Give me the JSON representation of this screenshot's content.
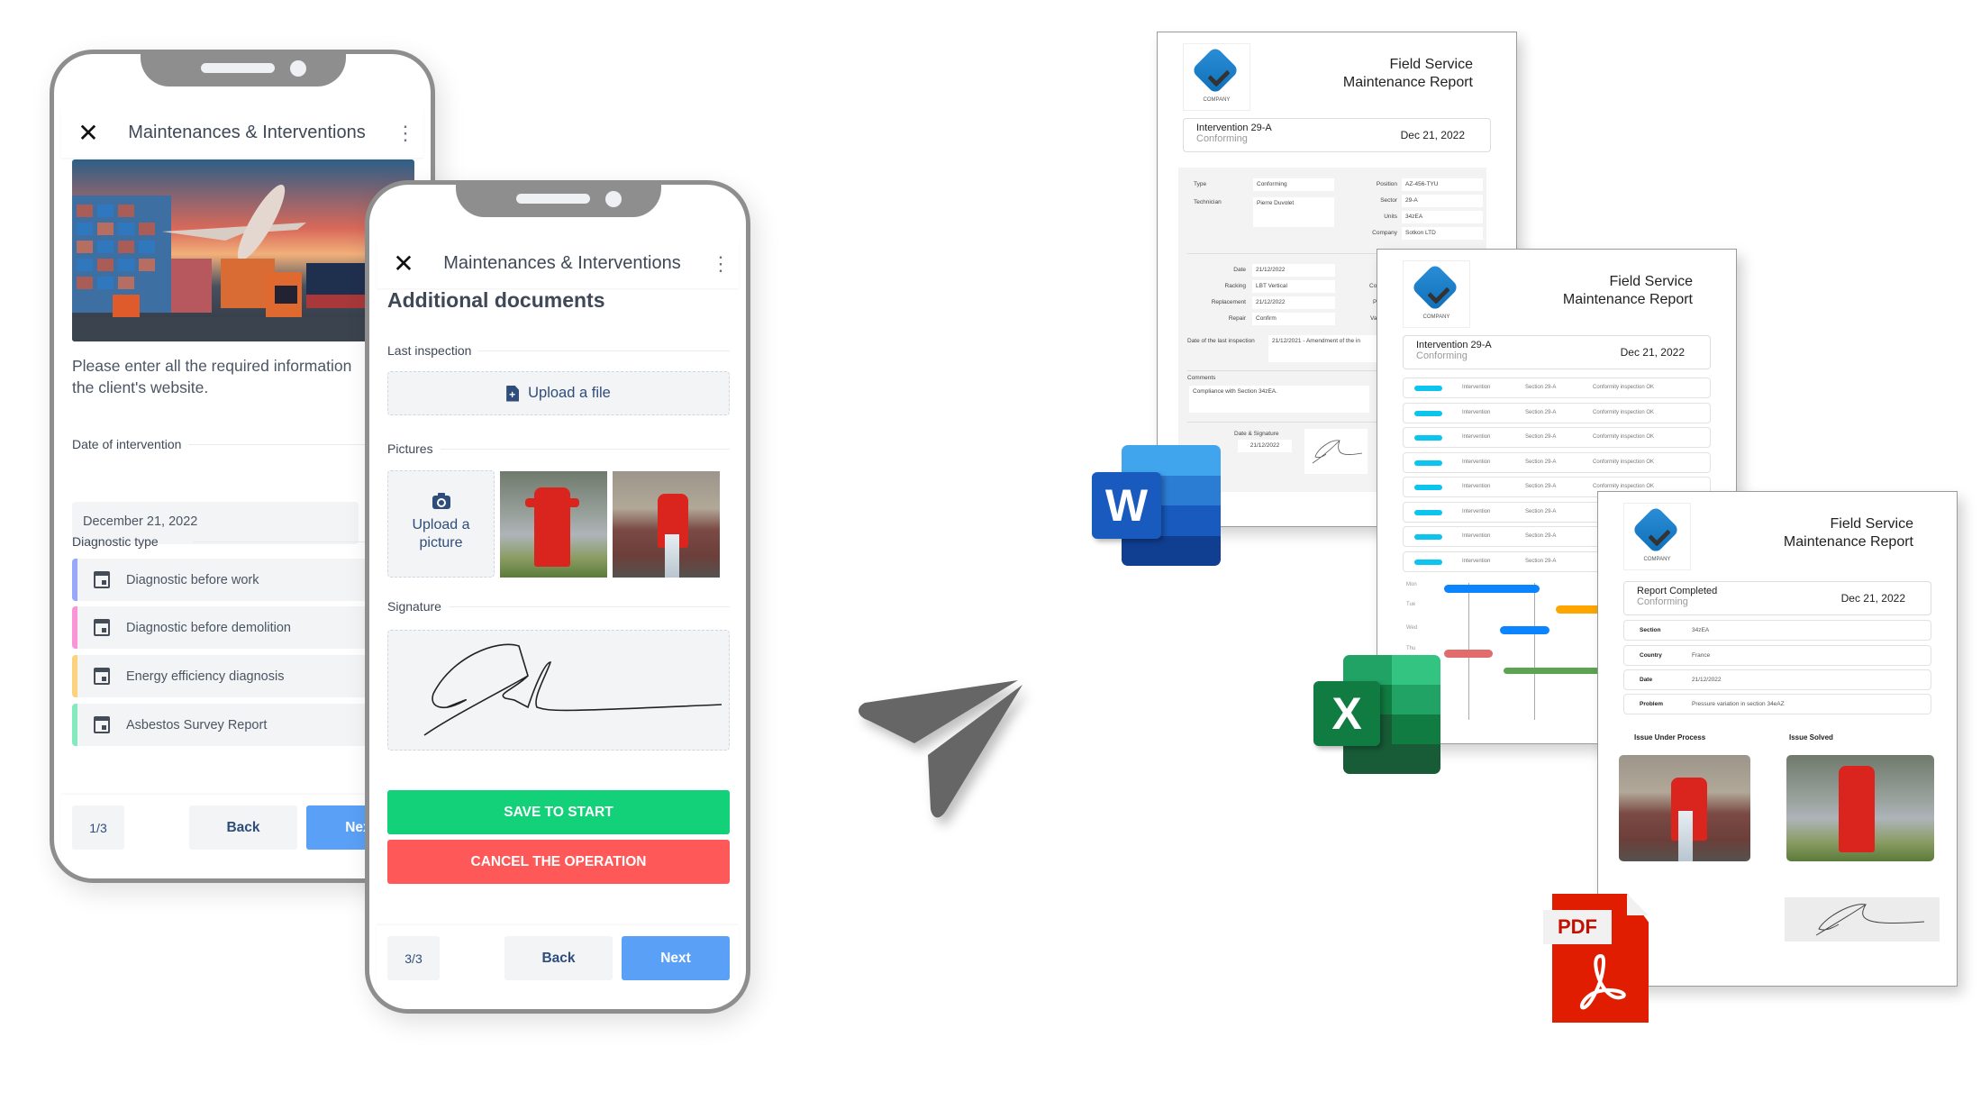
{
  "phone_left": {
    "app_title": "Maintenances & Interventions",
    "close_icon": "close-icon",
    "menu_icon": "more-vertical-icon",
    "intro_text": "Please enter all the required information and the client's website.",
    "intro_line1": "Please enter all the required information",
    "intro_line2": "the client's website.",
    "date_label": "Date of intervention",
    "date_value": "December 21, 2022",
    "diagnostic_label": "Diagnostic type",
    "diagnostic_options": [
      {
        "label": "Diagnostic before work",
        "color": "#97a8fb"
      },
      {
        "label": "Diagnostic before demolition",
        "color": "#f995d7"
      },
      {
        "label": "Energy efficiency diagnosis",
        "color": "#fdd27c"
      },
      {
        "label": "Asbestos Survey Report",
        "color": "#83eabd"
      }
    ],
    "page_indicator": "1/3",
    "back_label": "Back",
    "next_label": "Next"
  },
  "phone_right": {
    "app_title": "Maintenances & Interventions",
    "heading": "Additional documents",
    "last_inspection_label": "Last inspection",
    "upload_file_label": "Upload a file",
    "pictures_label": "Pictures",
    "upload_picture_label_1": "Upload a",
    "upload_picture_label_2": "picture",
    "signature_label": "Signature",
    "save_label": "SAVE TO START",
    "cancel_label": "CANCEL THE OPERATION",
    "page_indicator": "3/3",
    "back_label": "Back",
    "next_label": "Next"
  },
  "colors": {
    "save": "#12d178",
    "cancel": "#fe5858",
    "next": "#5aa0f7",
    "text_primary": "#2f4d7a"
  },
  "send_icon": "paper-plane-icon",
  "reports": [
    {
      "format": "Word",
      "logo_text": "COMPANY",
      "title_line1": "Field Service",
      "title_line2": "Maintenance Report",
      "header_title": "Intervention 29-A",
      "header_status": "Conforming",
      "header_date": "Dec 21, 2022",
      "fields_left": [
        {
          "label": "Type",
          "value": "Conforming"
        },
        {
          "label": "Technician",
          "value": "Pierre Duvolet"
        }
      ],
      "fields_right": [
        {
          "label": "Position",
          "value": "AZ-456-TYU"
        },
        {
          "label": "Sector",
          "value": "29-A"
        },
        {
          "label": "Units",
          "value": "34zEA"
        },
        {
          "label": "Company",
          "value": "Sotkon LTD"
        }
      ],
      "fields_lower": [
        {
          "label": "Date",
          "value": "21/12/2022"
        },
        {
          "label": "Racking",
          "value": "LBT Vertical"
        },
        {
          "label": "Replacement",
          "value": "21/12/2022"
        },
        {
          "label": "Repair",
          "value": "Confirm"
        }
      ],
      "fields_lower_right_labels": [
        "Con",
        "Pi",
        "Val"
      ],
      "last_inspection_label": "Date of the last inspection",
      "last_inspection_value": "21/12/2021 - Amendment of the in",
      "comments_label": "Comments",
      "comments_value": "Compliance with Section 34zEA.",
      "signature_label": "Date & Signature",
      "signature_date": "21/12/2022"
    },
    {
      "format": "Excel",
      "logo_text": "COMPANY",
      "title_line1": "Field Service",
      "title_line2": "Maintenance Report",
      "header_title": "Intervention 29-A",
      "header_status": "Conforming",
      "header_date": "Dec 21, 2022",
      "rows": [
        {
          "type": "Intervention",
          "section": "Section 29-A",
          "result": "Conformity inspection OK"
        },
        {
          "type": "Intervention",
          "section": "Section 29-A",
          "result": "Conformity inspection OK"
        },
        {
          "type": "Intervention",
          "section": "Section 29-A",
          "result": "Conformity inspection OK"
        },
        {
          "type": "Intervention",
          "section": "Section 29-A",
          "result": "Conformity inspection OK"
        },
        {
          "type": "Intervention",
          "section": "Section 29-A",
          "result": "Conformity inspection OK"
        },
        {
          "type": "Intervention",
          "section": "Section 29-A",
          "result": ""
        },
        {
          "type": "Intervention",
          "section": "Section 29-A",
          "result": ""
        },
        {
          "type": "Intervention",
          "section": "Section 29-A",
          "result": ""
        }
      ],
      "gantt_days": [
        "Mon",
        "Tue",
        "Wed",
        "Thu"
      ],
      "gantt_colors": [
        "#0a84ff",
        "#ffa500",
        "#0a84ff",
        "#e06c6c",
        "#5ca451"
      ]
    },
    {
      "format": "PDF",
      "logo_text": "COMPANY",
      "title_line1": "Field Service",
      "title_line2": "Maintenance Report",
      "header_title": "Report Completed",
      "header_status": "Conforming",
      "header_date": "Dec 21, 2022",
      "details": [
        {
          "label": "Section",
          "value": "34zEA"
        },
        {
          "label": "Country",
          "value": "France"
        },
        {
          "label": "Date",
          "value": "21/12/2022"
        },
        {
          "label": "Problem",
          "value": "Pressure variation in section 34eAZ"
        }
      ],
      "photo_left_label": "Issue Under Process",
      "photo_right_label": "Issue Solved"
    }
  ],
  "format_icons": {
    "word_letter": "W",
    "excel_letter": "X",
    "pdf_label": "PDF"
  }
}
